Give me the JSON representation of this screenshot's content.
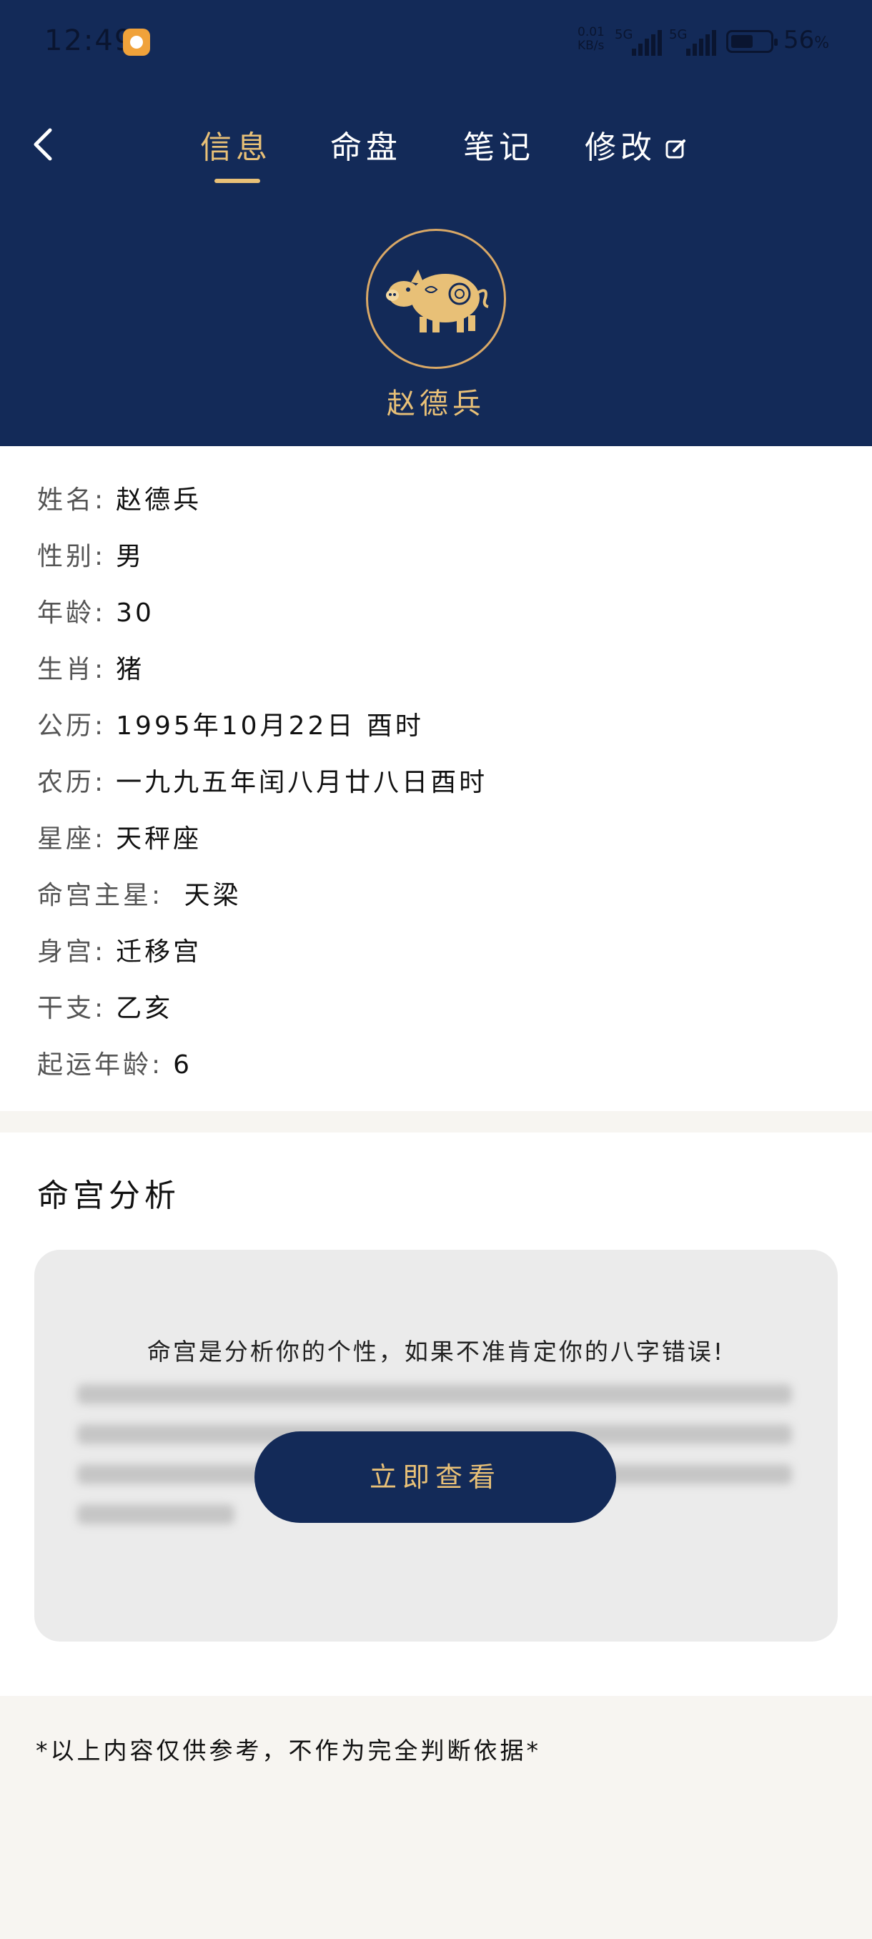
{
  "status_bar": {
    "time": "12:49",
    "net_speed_top": "0.01",
    "net_speed_bottom": "KB/s",
    "sim1": "5G",
    "sim2": "5G",
    "battery_percent": "56",
    "battery_unit": "%"
  },
  "nav": {
    "tabs": [
      {
        "label": "信息",
        "active": true
      },
      {
        "label": "命盘",
        "active": false
      },
      {
        "label": "笔记",
        "active": false
      },
      {
        "label": "修改",
        "active": false
      }
    ]
  },
  "profile": {
    "zodiac_icon": "pig-icon",
    "name": "赵德兵"
  },
  "info": {
    "rows": [
      {
        "key": "姓名:",
        "value": "赵德兵"
      },
      {
        "key": "性别:",
        "value": "男"
      },
      {
        "key": "年龄:",
        "value": "30"
      },
      {
        "key": "生肖:",
        "value": "猪"
      },
      {
        "key": "公历:",
        "value": "1995年10月22日 酉时"
      },
      {
        "key": "农历:",
        "value": "一九九五年闰八月廿八日酉时"
      },
      {
        "key": "星座:",
        "value": "天秤座"
      },
      {
        "key": "命宫主星:",
        "value": " 天梁"
      },
      {
        "key": "身宫:",
        "value": "迁移宫"
      },
      {
        "key": "干支:",
        "value": "乙亥"
      },
      {
        "key": "起运年龄:",
        "value": "6"
      }
    ]
  },
  "analysis": {
    "title": "命宫分析",
    "intro": "命宫是分析你的个性，如果不准肯定你的八字错误!",
    "button_label": "立即查看"
  },
  "footer": {
    "note": "*以上内容仅供参考，不作为完全判断依据*"
  },
  "colors": {
    "header_bg": "#132a58",
    "accent_gold": "#e8c077"
  }
}
